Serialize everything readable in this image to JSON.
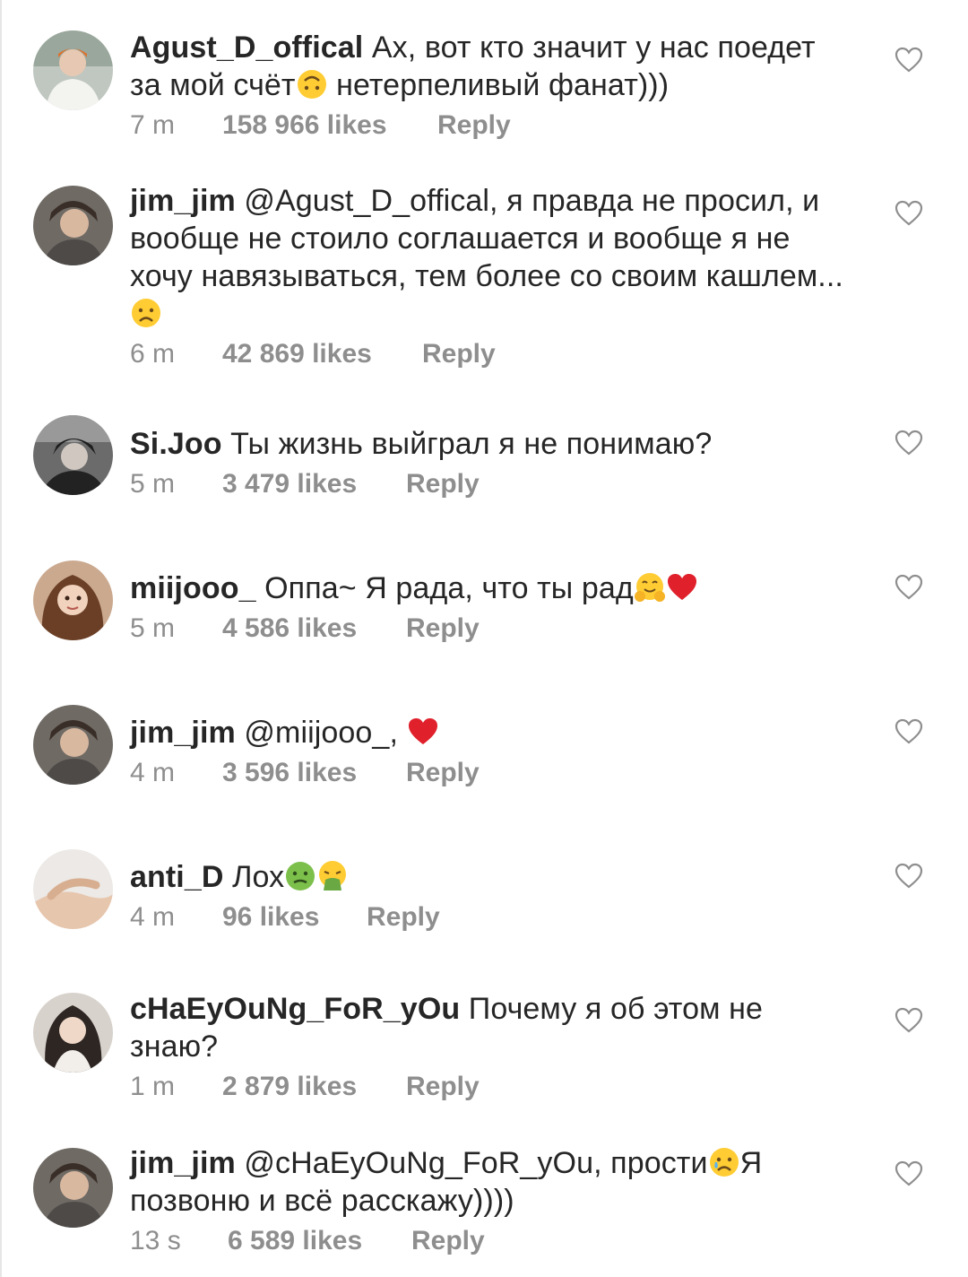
{
  "colors": {
    "text": "#262626",
    "meta": "#8e8e8e",
    "heart_outline": "#8e8e8e",
    "red_heart": "#e0202b",
    "emoji_yellow": "#ffcc33"
  },
  "comments": [
    {
      "username": "Agust_D_offical",
      "text_before": "Ах, вот кто значит у нас поедет за мой счёт",
      "emoji": "upside-down-face-emoji",
      "text_after": " нетерпеливый фанат)))",
      "time": "7 m",
      "likes": "158 966 likes",
      "reply": "Reply"
    },
    {
      "username": "jim_jim",
      "text_before": "@Agust_D_offical, я правда не просил, и вообще не стоило соглашается и вообще я не хочу навязываться, тем более со своим кашлем...",
      "emoji": "worried-face-emoji",
      "text_after": "",
      "time": "6 m",
      "likes": "42 869 likes",
      "reply": "Reply"
    },
    {
      "username": "Si.Joo",
      "text_before": "Ты жизнь выйграл я не понимаю?",
      "emoji": "",
      "text_after": "",
      "time": "5 m",
      "likes": "3 479 likes",
      "reply": "Reply"
    },
    {
      "username": "miijooo_",
      "text_before": "Оппа~ Я рада, что ты рад",
      "emoji": "hugging-face-emoji",
      "emoji2": "red-heart-emoji",
      "text_after": "",
      "time": "5 m",
      "likes": "4 586 likes",
      "reply": "Reply"
    },
    {
      "username": "jim_jim",
      "text_before": "@miijooo_,",
      "emoji": "red-heart-emoji",
      "text_after": "",
      "time": "4 m",
      "likes": "3 596 likes",
      "reply": "Reply"
    },
    {
      "username": "anti_D",
      "text_before": "Лох",
      "emoji": "nauseated-face-emoji",
      "emoji2": "vomiting-face-emoji",
      "text_after": "",
      "time": "4 m",
      "likes": "96 likes",
      "reply": "Reply"
    },
    {
      "username": "cHaEyOuNg_FoR_yOu",
      "text_before": "Почему я об этом не знаю?",
      "emoji": "",
      "text_after": "",
      "time": "1 m",
      "likes": "2 879 likes",
      "reply": "Reply"
    },
    {
      "username": "jim_jim",
      "text_before": "@cHaEyOuNg_FoR_yOu, прости",
      "emoji": "sad-sweat-face-emoji",
      "text_after": "Я позвоню и всё расскажу))))",
      "time": "13 s",
      "likes": "6 589 likes",
      "reply": "Reply"
    }
  ]
}
